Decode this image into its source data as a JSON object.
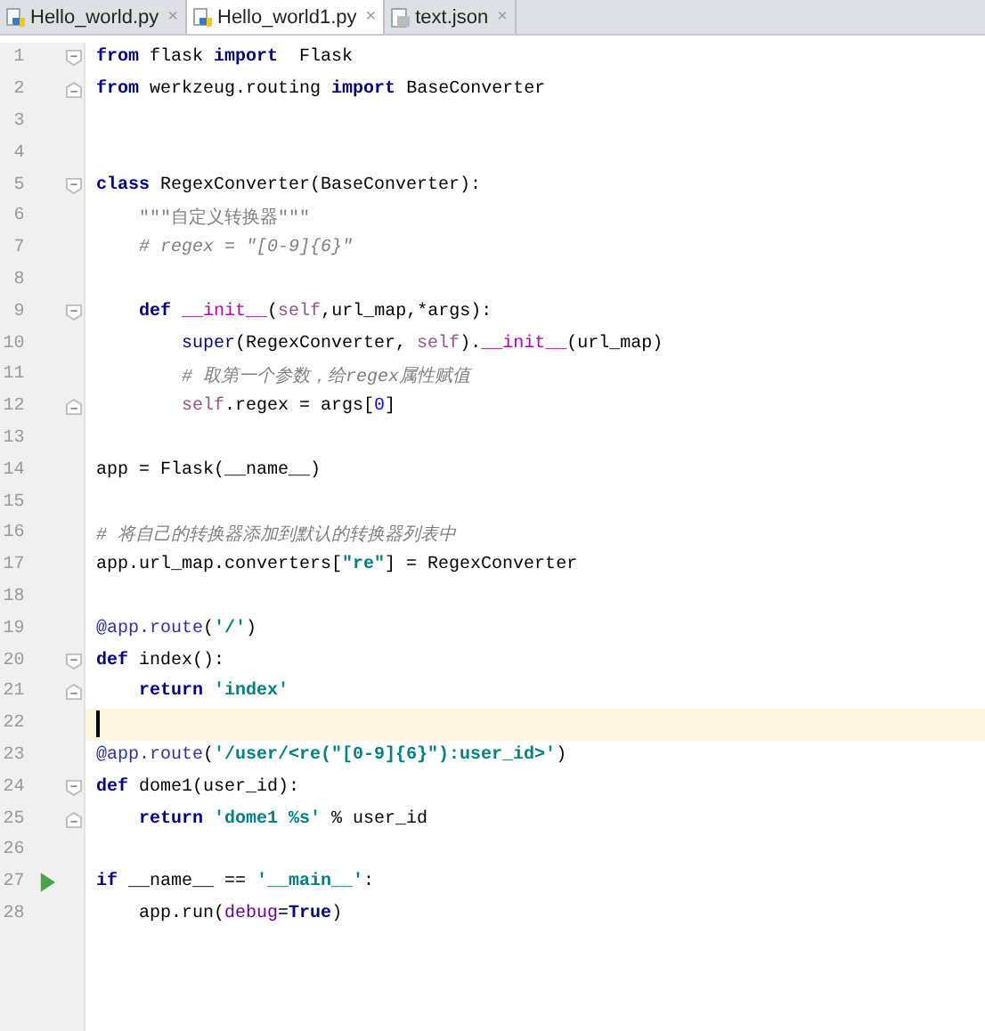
{
  "tabs": [
    {
      "label": "Hello_world.py",
      "close": "×",
      "kind": "python",
      "selected": false
    },
    {
      "label": "Hello_world1.py",
      "close": "×",
      "kind": "python",
      "selected": true
    },
    {
      "label": "text.json",
      "close": "×",
      "kind": "json",
      "selected": false
    }
  ],
  "editor": {
    "lines": [
      {
        "number": "1",
        "fold": {
          "kind": "start"
        },
        "run": false,
        "current": false,
        "tokens": [
          {
            "text": "from",
            "kind": "kw"
          },
          {
            "text": " flask ",
            "kind": "plain"
          },
          {
            "text": "import",
            "kind": "kw"
          },
          {
            "text": "  Flask",
            "kind": "plain"
          }
        ]
      },
      {
        "number": "2",
        "fold": {
          "kind": "end"
        },
        "run": false,
        "current": false,
        "tokens": [
          {
            "text": "from",
            "kind": "kw"
          },
          {
            "text": " werkzeug.routing ",
            "kind": "plain"
          },
          {
            "text": "import",
            "kind": "kw"
          },
          {
            "text": " BaseConverter",
            "kind": "plain"
          }
        ]
      },
      {
        "number": "3",
        "run": false,
        "current": false
      },
      {
        "number": "4",
        "run": false,
        "current": false
      },
      {
        "number": "5",
        "fold": {
          "kind": "start"
        },
        "run": false,
        "current": false,
        "tokens": [
          {
            "text": "class",
            "kind": "kw"
          },
          {
            "text": " RegexConverter(BaseConverter):",
            "kind": "plain"
          }
        ]
      },
      {
        "number": "6",
        "run": false,
        "current": false,
        "tokens": [
          {
            "text": "    \"\"\"自定义转换器\"\"\"",
            "kind": "doc"
          }
        ]
      },
      {
        "number": "7",
        "run": false,
        "current": false,
        "tokens": [
          {
            "text": "    # regex = \"[0-9]{6}\"",
            "kind": "comment"
          }
        ]
      },
      {
        "number": "8",
        "run": false,
        "current": false
      },
      {
        "number": "9",
        "fold": {
          "kind": "start"
        },
        "run": false,
        "current": false,
        "tokens": [
          {
            "text": "    def",
            "kind": "kw"
          },
          {
            "text": " __init__",
            "kind": "magic"
          },
          {
            "text": "(",
            "kind": "plain"
          },
          {
            "text": "self",
            "kind": "self"
          },
          {
            "text": ",url_map,*args):",
            "kind": "plain"
          }
        ]
      },
      {
        "number": "10",
        "run": false,
        "current": false,
        "tokens": [
          {
            "text": "        super",
            "kind": "builtin"
          },
          {
            "text": "(RegexConverter, ",
            "kind": "plain"
          },
          {
            "text": "self",
            "kind": "self"
          },
          {
            "text": ").",
            "kind": "plain"
          },
          {
            "text": "__init__",
            "kind": "magic"
          },
          {
            "text": "(url_map)",
            "kind": "plain"
          }
        ]
      },
      {
        "number": "11",
        "run": false,
        "current": false,
        "tokens": [
          {
            "text": "        # 取第一个参数，给regex属性赋值",
            "kind": "comment"
          }
        ]
      },
      {
        "number": "12",
        "fold": {
          "kind": "end"
        },
        "run": false,
        "current": false,
        "tokens": [
          {
            "text": "        self",
            "kind": "self"
          },
          {
            "text": ".regex = args[",
            "kind": "plain"
          },
          {
            "text": "0",
            "kind": "num"
          },
          {
            "text": "]",
            "kind": "plain"
          }
        ]
      },
      {
        "number": "13",
        "run": false,
        "current": false
      },
      {
        "number": "14",
        "run": false,
        "current": false,
        "tokens": [
          {
            "text": "app = Flask(__name__)",
            "kind": "plain"
          }
        ]
      },
      {
        "number": "15",
        "run": false,
        "current": false
      },
      {
        "number": "16",
        "run": false,
        "current": false,
        "tokens": [
          {
            "text": "# 将自己的转换器添加到默认的转换器列表中",
            "kind": "comment"
          }
        ]
      },
      {
        "number": "17",
        "run": false,
        "current": false,
        "tokens": [
          {
            "text": "app.url_map.converters[",
            "kind": "plain"
          },
          {
            "text": "\"re\"",
            "kind": "str"
          },
          {
            "text": "] = RegexConverter",
            "kind": "plain"
          }
        ]
      },
      {
        "number": "18",
        "run": false,
        "current": false
      },
      {
        "number": "19",
        "run": false,
        "current": false,
        "tokens": [
          {
            "text": "@app.route",
            "kind": "deco"
          },
          {
            "text": "(",
            "kind": "plain"
          },
          {
            "text": "'/'",
            "kind": "str"
          },
          {
            "text": ")",
            "kind": "plain"
          }
        ]
      },
      {
        "number": "20",
        "fold": {
          "kind": "start"
        },
        "run": false,
        "current": false,
        "tokens": [
          {
            "text": "def",
            "kind": "kw"
          },
          {
            "text": " index():",
            "kind": "plain"
          }
        ]
      },
      {
        "number": "21",
        "fold": {
          "kind": "end"
        },
        "run": false,
        "current": false,
        "tokens": [
          {
            "text": "    return",
            "kind": "kw"
          },
          {
            "text": " 'index'",
            "kind": "str"
          }
        ]
      },
      {
        "number": "22",
        "run": false,
        "current": true
      },
      {
        "number": "23",
        "run": false,
        "current": false,
        "tokens": [
          {
            "text": "@app.route",
            "kind": "deco"
          },
          {
            "text": "(",
            "kind": "plain"
          },
          {
            "text": "'/user/<re(\"[0-9]{6}\"):user_id>'",
            "kind": "str"
          },
          {
            "text": ")",
            "kind": "plain"
          }
        ]
      },
      {
        "number": "24",
        "fold": {
          "kind": "start"
        },
        "run": false,
        "current": false,
        "tokens": [
          {
            "text": "def",
            "kind": "kw"
          },
          {
            "text": " dome1(user_id):",
            "kind": "plain"
          }
        ]
      },
      {
        "number": "25",
        "fold": {
          "kind": "end"
        },
        "run": false,
        "current": false,
        "tokens": [
          {
            "text": "    return",
            "kind": "kw"
          },
          {
            "text": " 'dome1 %s'",
            "kind": "str"
          },
          {
            "text": " % user_id",
            "kind": "plain"
          }
        ]
      },
      {
        "number": "26",
        "run": false,
        "current": false
      },
      {
        "number": "27",
        "run": true,
        "current": false,
        "tokens": [
          {
            "text": "if",
            "kind": "kw"
          },
          {
            "text": " __name__ == ",
            "kind": "plain"
          },
          {
            "text": "'__main__'",
            "kind": "str"
          },
          {
            "text": ":",
            "kind": "plain"
          }
        ]
      },
      {
        "number": "28",
        "run": false,
        "current": false,
        "tokens": [
          {
            "text": "    app.run(",
            "kind": "plain"
          },
          {
            "text": "debug",
            "kind": "param"
          },
          {
            "text": "=",
            "kind": "plain"
          },
          {
            "text": "True",
            "kind": "kw"
          },
          {
            "text": ")",
            "kind": "plain"
          }
        ]
      }
    ]
  }
}
